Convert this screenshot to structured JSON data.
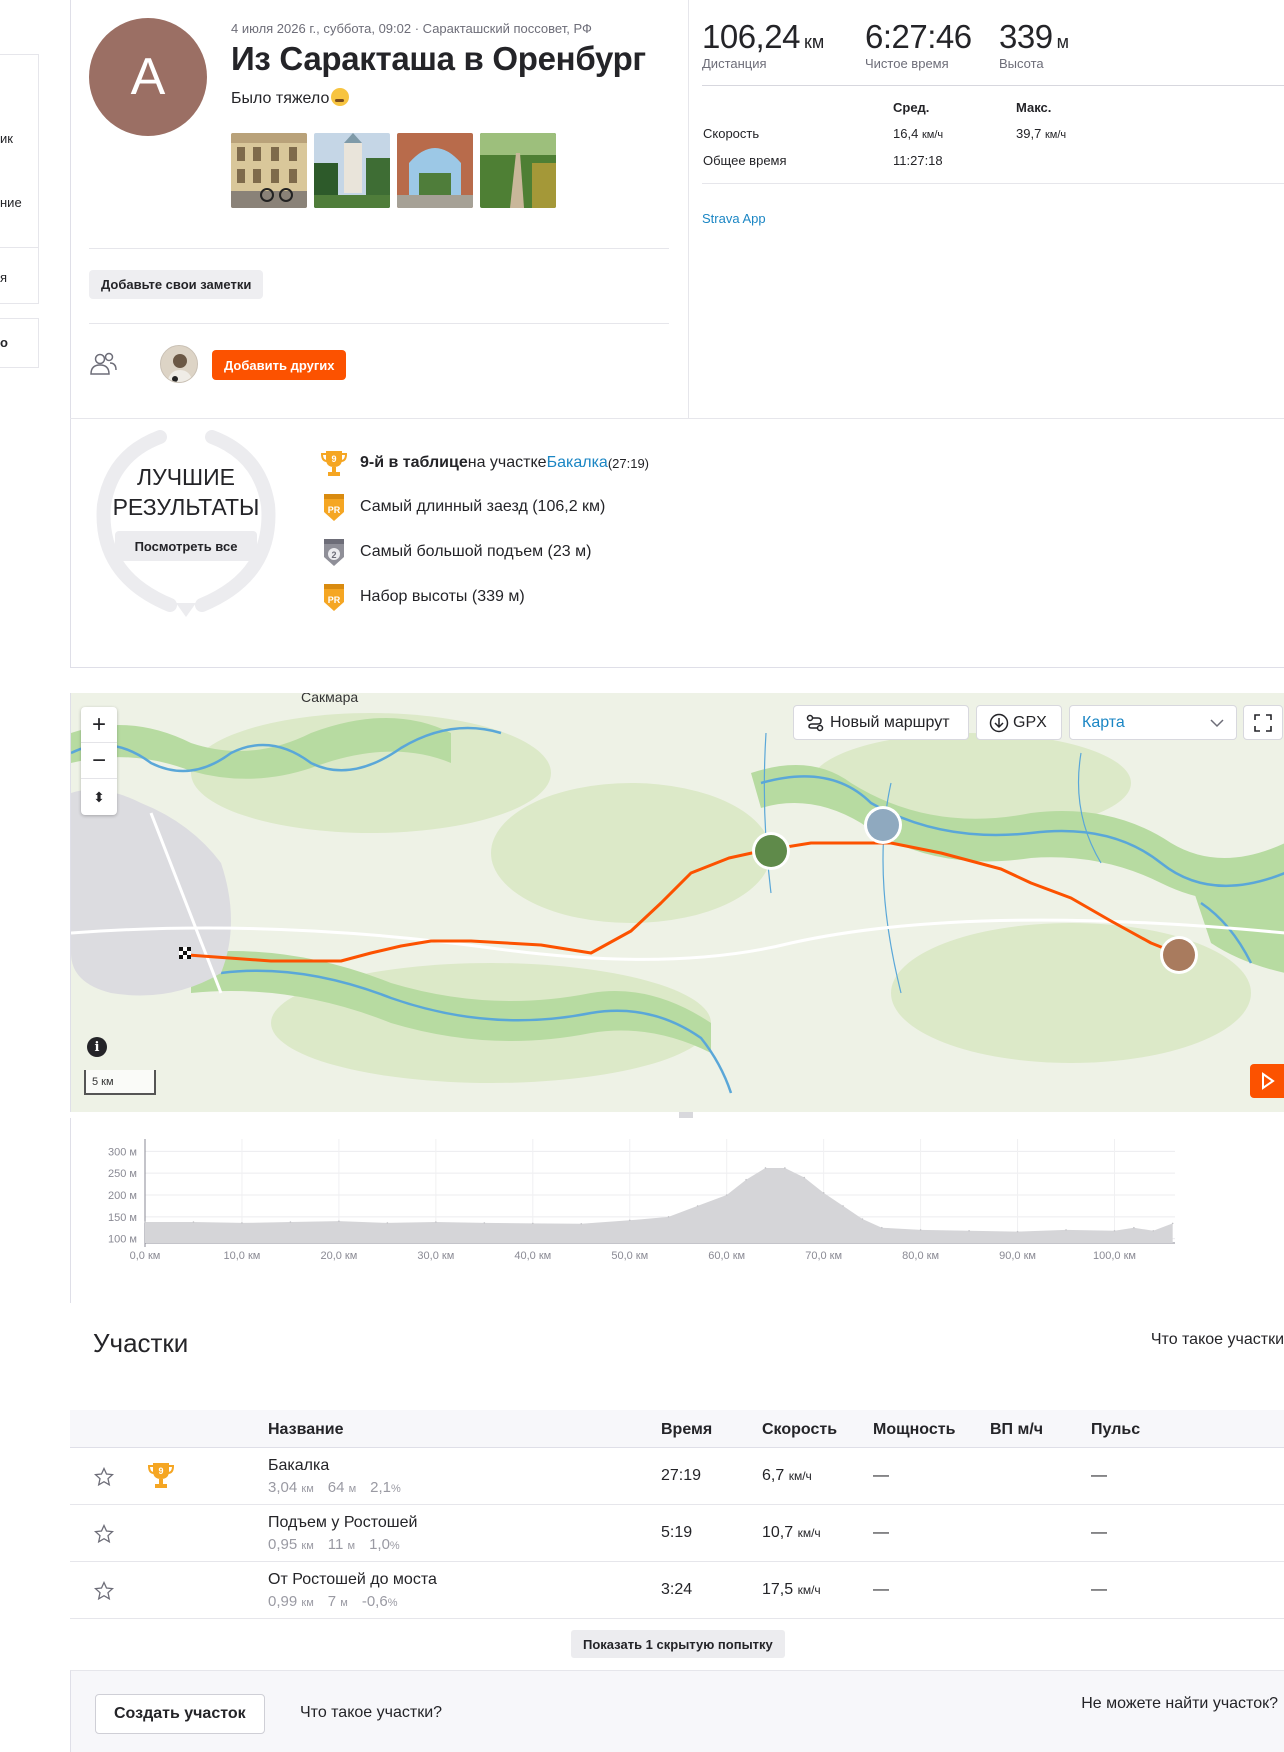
{
  "sidebar_fragments": [
    "ик",
    "ние",
    "я",
    "о"
  ],
  "activity": {
    "avatar_letter": "A",
    "meta": "4 июля 2026 г., суббота, 09:02 · Саракташский поссовет, РФ",
    "title": "Из Саракташа в Оренбург",
    "description": "Было тяжело",
    "notes_button": "Добавьте свои заметки",
    "add_others_button": "Добавить других"
  },
  "stats": {
    "distance": {
      "value": "106,24",
      "unit": "км",
      "label": "Дистанция"
    },
    "moving_time": {
      "value": "6:27:46",
      "label": "Чистое время"
    },
    "elevation": {
      "value": "339",
      "unit": "м",
      "label": "Высота"
    },
    "col_avg": "Сред.",
    "col_max": "Макс.",
    "speed_label": "Скорость",
    "speed_avg": "16,4",
    "speed_max": "39,7",
    "speed_unit": "км/ч",
    "elapsed_label": "Общее время",
    "elapsed_avg": "11:27:18",
    "device": "Strava App"
  },
  "achievements": {
    "title_line1": "ЛУЧШИЕ",
    "title_line2": "РЕЗУЛЬТАТЫ",
    "see_all": "Посмотреть все",
    "items": [
      {
        "bold": "9-й в таблице",
        "text": " на участке ",
        "link": "Бакалка",
        "extra": " (27:19)"
      },
      {
        "text": "Самый длинный заезд  (106,2 км)"
      },
      {
        "text": "Самый большой подъем  (23 м)"
      },
      {
        "text": "Набор высоты  (339 м)"
      }
    ]
  },
  "map": {
    "town_label": "Сакмара",
    "new_route_button": "Новый маршрут",
    "gpx_button": "GPX",
    "map_type_select": "Карта",
    "scale_label": "5 км",
    "accent_color": "#fc5200"
  },
  "elevation_chart": {
    "y_ticks": [
      "300 м",
      "250 м",
      "200 м",
      "150 м",
      "100 м"
    ],
    "x_ticks": [
      "0,0 км",
      "10,0 км",
      "20,0 км",
      "30,0 км",
      "40,0 км",
      "50,0 км",
      "60,0 км",
      "70,0 км",
      "80,0 км",
      "90,0 км",
      "100,0 км"
    ]
  },
  "chart_data": {
    "type": "area",
    "xlabel": "",
    "ylabel": "",
    "xlim": [
      0,
      106.24
    ],
    "ylim": [
      90,
      310
    ],
    "x": [
      0,
      5,
      10,
      15,
      20,
      25,
      30,
      35,
      40,
      45,
      50,
      54,
      57,
      60,
      62,
      64,
      66,
      68,
      70,
      72,
      74,
      76,
      80,
      85,
      90,
      95,
      100,
      102,
      104,
      106
    ],
    "y": [
      138,
      138,
      136,
      138,
      140,
      136,
      138,
      136,
      135,
      134,
      142,
      150,
      175,
      200,
      235,
      262,
      262,
      240,
      205,
      175,
      145,
      125,
      120,
      118,
      116,
      120,
      118,
      125,
      118,
      135
    ],
    "grid": true
  },
  "segments": {
    "heading": "Участки",
    "what_link_top": "Что такое участки",
    "columns": [
      "Название",
      "Время",
      "Скорость",
      "Мощность",
      "ВП м/ч",
      "Пульс"
    ],
    "rows": [
      {
        "name": "Бакалка",
        "dist": "3,04",
        "dist_u": "км",
        "elev": "64",
        "elev_u": "м",
        "grade": "2,1",
        "grade_u": "%",
        "time": "27:19",
        "speed": "6,7",
        "speed_u": "км/ч",
        "power": "—",
        "pulse": "—",
        "trophy": "9"
      },
      {
        "name": "Подъем у Ростошей",
        "dist": "0,95",
        "dist_u": "км",
        "elev": "11",
        "elev_u": "м",
        "grade": "1,0",
        "grade_u": "%",
        "time": "5:19",
        "speed": "10,7",
        "speed_u": "км/ч",
        "power": "—",
        "pulse": "—"
      },
      {
        "name": "От Ростошей до моста",
        "dist": "0,99",
        "dist_u": "км",
        "elev": "7",
        "elev_u": "м",
        "grade": "-0,6",
        "grade_u": "%",
        "time": "3:24",
        "speed": "17,5",
        "speed_u": "км/ч",
        "power": "—",
        "pulse": "—"
      }
    ],
    "show_hidden": "Показать 1 скрытую попытку",
    "create_button": "Создать участок",
    "what_link_bottom": "Что такое участки?",
    "cant_find": "Не можете найти участок?"
  }
}
